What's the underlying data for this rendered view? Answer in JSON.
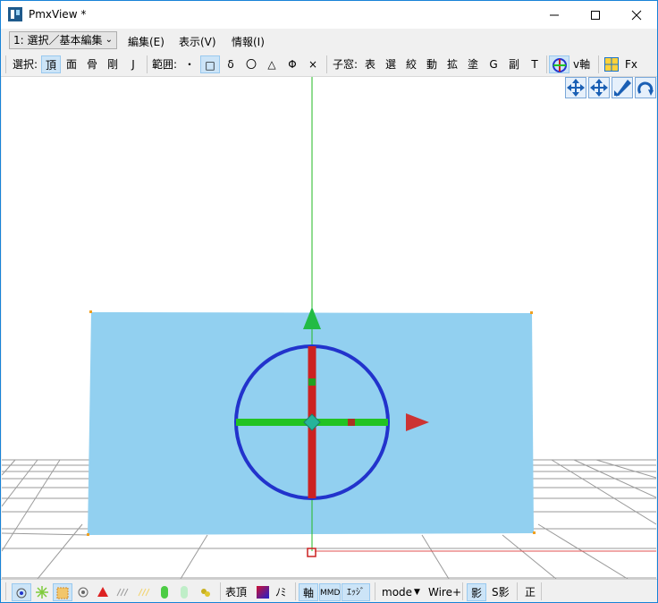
{
  "window": {
    "title": "PmxView *"
  },
  "menubar": {
    "mode_select": "1: 選択／基本編集",
    "items": [
      "編集(E)",
      "表示(V)",
      "情報(I)"
    ]
  },
  "toolbar": {
    "select_label": "選択:",
    "select_items": [
      "頂",
      "面",
      "骨",
      "剛",
      "J"
    ],
    "range_label": "範囲:",
    "range_items": [
      "・",
      "□",
      "δ",
      "〇",
      "△",
      "Φ",
      "×"
    ],
    "child_label": "子窓:",
    "child_items": [
      "表",
      "選",
      "絞",
      "動",
      "拡",
      "塗",
      "G",
      "副",
      "T"
    ],
    "axis_label": "v軸",
    "fx_label": "Fx"
  },
  "statusbar": {
    "vertex_label": "表頂",
    "no_label": "ﾉﾐ",
    "axis_label": "軸",
    "mmd_label": "MMD",
    "edge_label": "ｴｯｼﾞ",
    "mode_label": "mode",
    "wire_label": "Wire+",
    "shadow_label": "影",
    "sshadow_label": "S影",
    "front_label": "正"
  },
  "colors": {
    "accent": "#1883d7",
    "plane": "#92d0f0",
    "x_axis": "#22c322",
    "y_axis": "#cc2222",
    "ring": "#2233cc",
    "arrow_x": "#cc3333",
    "arrow_y": "#22bb44"
  }
}
